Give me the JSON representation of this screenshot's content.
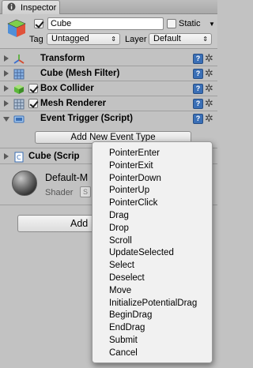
{
  "tab": {
    "label": "Inspector"
  },
  "header": {
    "name_value": "Cube",
    "static_label": "Static",
    "tag_label": "Tag",
    "tag_value": "Untagged",
    "layer_label": "Layer",
    "layer_value": "Default"
  },
  "components": [
    {
      "title": "Transform"
    },
    {
      "title": "Cube (Mesh Filter)"
    },
    {
      "title": "Box Collider"
    },
    {
      "title": "Mesh Renderer"
    },
    {
      "title": "Event Trigger (Script)"
    },
    {
      "title": "Cube (Scrip"
    }
  ],
  "event_trigger": {
    "add_event_label": "Add New Event Type"
  },
  "material": {
    "name": "Default-M",
    "shader_label": "Shader",
    "shader_value": "S"
  },
  "add_component": {
    "label": "Add"
  },
  "menu": {
    "items": [
      "PointerEnter",
      "PointerExit",
      "PointerDown",
      "PointerUp",
      "PointerClick",
      "Drag",
      "Drop",
      "Scroll",
      "UpdateSelected",
      "Select",
      "Deselect",
      "Move",
      "InitializePotentialDrag",
      "BeginDrag",
      "EndDrag",
      "Submit",
      "Cancel"
    ]
  },
  "icons": {
    "help": "help-icon",
    "gear": "gear-icon"
  },
  "colors": {
    "panel": "#c2c2c2",
    "help_blue": "#3a6fb6",
    "menu_bg": "#f1f1f1"
  }
}
